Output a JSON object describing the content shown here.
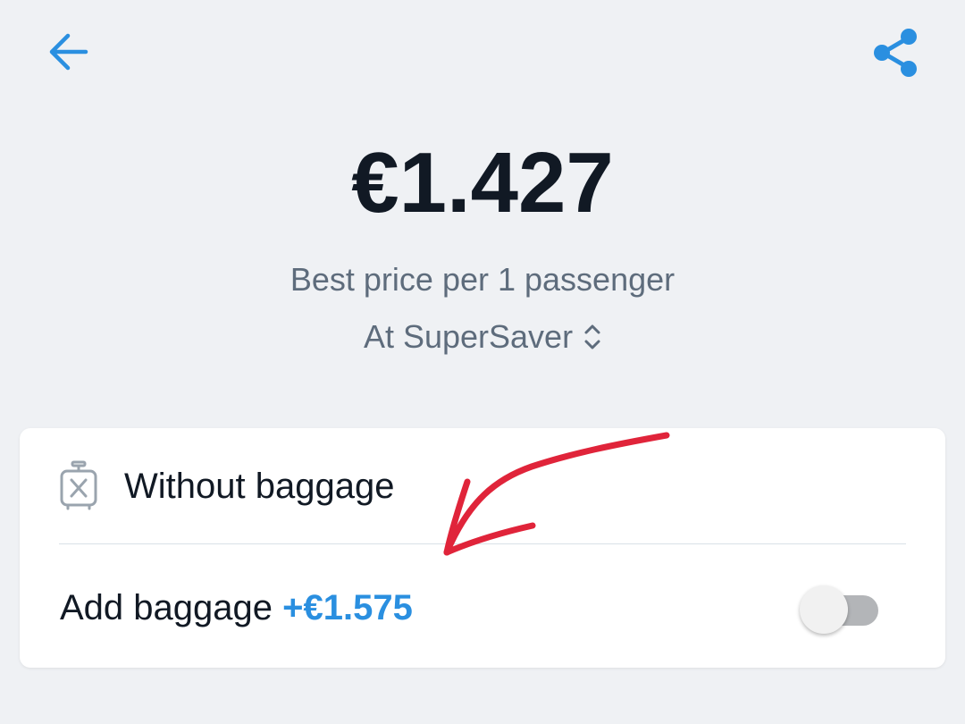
{
  "header": {
    "back_icon": "arrow-left-icon",
    "share_icon": "share-icon"
  },
  "price": {
    "amount": "€1.427",
    "caption": "Best price per 1 passenger",
    "provider": "At SuperSaver",
    "provider_icon": "unfold-chevrons-icon"
  },
  "baggage": {
    "without_label": "Without baggage",
    "without_icon": "no-luggage-icon",
    "add_label": "Add baggage",
    "add_price": "+€1.575",
    "toggle_on": false
  },
  "colors": {
    "accent": "#2a8fe0",
    "annotation": "#e0243a",
    "text_dark": "#111924",
    "text_muted": "#5e6c7c"
  }
}
